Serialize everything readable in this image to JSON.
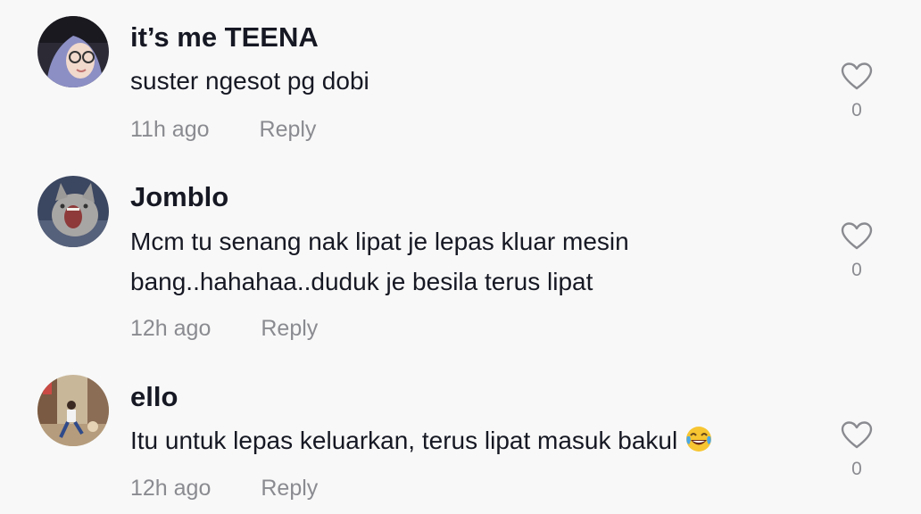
{
  "comments": [
    {
      "username": "it’s me TEENA",
      "text_lines": [
        "suster ngesot pg dobi"
      ],
      "time": "11h ago",
      "reply_label": "Reply",
      "likes": "0",
      "avatar_icon": "avatar-girl-hijab-glasses"
    },
    {
      "username": "Jomblo",
      "text_lines": [
        "Mcm tu senang nak lipat je lepas kluar mesin",
        "bang..hahahaa..duduk je besila terus lipat"
      ],
      "time": "12h ago",
      "reply_label": "Reply",
      "likes": "0",
      "avatar_icon": "avatar-yawning-cat"
    },
    {
      "username": "ello",
      "text_lines": [
        "Itu untuk lepas keluarkan, terus lipat masuk bakul"
      ],
      "time": "12h ago",
      "reply_label": "Reply",
      "likes": "0",
      "avatar_icon": "avatar-dancer-street",
      "emoji": "😂"
    }
  ],
  "colors": {
    "background": "#f8f8f8",
    "text_primary": "#161823",
    "text_secondary": "#8a8b91",
    "icon_outline": "#8a8b91"
  }
}
